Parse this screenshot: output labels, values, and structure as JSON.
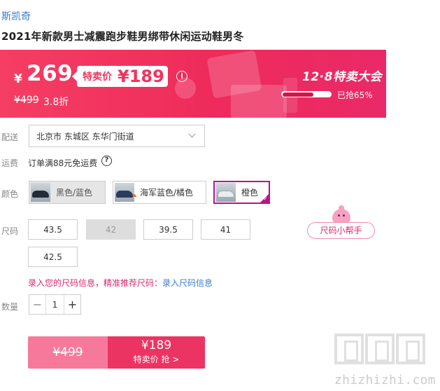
{
  "brand": "斯凯奇",
  "product_title": "2021年新款男士减震跑步鞋男绑带休闲运动鞋男冬",
  "price_banner": {
    "currency_symbol": "¥",
    "current_price": "269",
    "special_label": "特卖价",
    "special_price": "¥189",
    "info_icon": "i",
    "original_price": "¥499",
    "discount": "3.8折",
    "event_title": "12·8特卖大会",
    "progress_percent": 65,
    "progress_text": "已抢65%"
  },
  "delivery": {
    "label": "配送",
    "address": "北京市 东城区 东华门街道"
  },
  "shipping": {
    "label": "运费",
    "text": "订单满88元免运费",
    "help_icon": "?"
  },
  "color": {
    "label": "颜色",
    "options": [
      {
        "name": "黑色/蓝色",
        "state": "disabled"
      },
      {
        "name": "海军蓝色/橘色",
        "state": "normal"
      },
      {
        "name": "橙色",
        "state": "selected"
      }
    ]
  },
  "size": {
    "label": "尺码",
    "options": [
      {
        "value": "43.5",
        "state": "normal"
      },
      {
        "value": "42",
        "state": "disabled"
      },
      {
        "value": "39.5",
        "state": "normal"
      },
      {
        "value": "41",
        "state": "normal"
      },
      {
        "value": "42.5",
        "state": "normal"
      }
    ],
    "helper_button": "尺码小帮手",
    "hint_text": "录入您的尺码信息，精准推荐尺码：",
    "hint_link": "录入尺码信息"
  },
  "quantity": {
    "label": "数量",
    "minus": "−",
    "value": "1",
    "plus": "+"
  },
  "buy": {
    "original_price": "¥499",
    "special_price": "¥189",
    "special_label": "特卖价 抢 >"
  },
  "watermark": {
    "text": "zhizhizhi.com"
  },
  "colors": {
    "accent": "#ec3463",
    "brand_link": "#3a7bd5",
    "selected_border": "#b8148e"
  }
}
